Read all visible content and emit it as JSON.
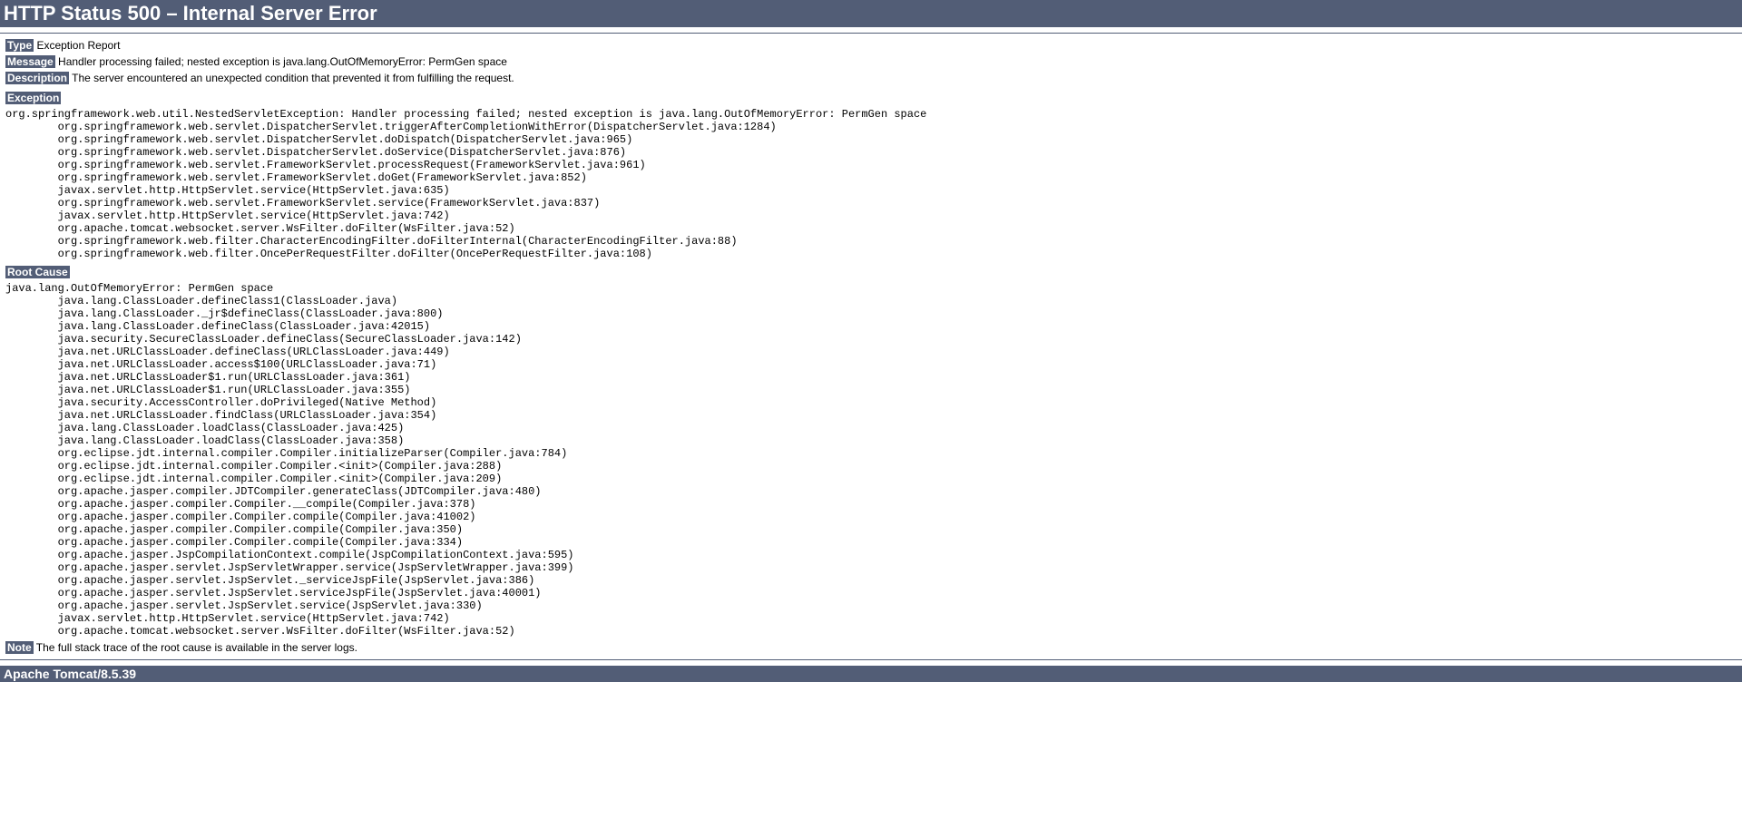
{
  "header": {
    "title": "HTTP Status 500 – Internal Server Error"
  },
  "labels": {
    "type": "Type",
    "message": "Message",
    "description": "Description",
    "exception": "Exception",
    "rootCause": "Root Cause",
    "note": "Note"
  },
  "values": {
    "type": " Exception Report",
    "message": " Handler processing failed; nested exception is java.lang.OutOfMemoryError: PermGen space",
    "description": " The server encountered an unexpected condition that prevented it from fulfilling the request.",
    "note": " The full stack trace of the root cause is available in the server logs."
  },
  "exceptionTrace": "org.springframework.web.util.NestedServletException: Handler processing failed; nested exception is java.lang.OutOfMemoryError: PermGen space\n\torg.springframework.web.servlet.DispatcherServlet.triggerAfterCompletionWithError(DispatcherServlet.java:1284)\n\torg.springframework.web.servlet.DispatcherServlet.doDispatch(DispatcherServlet.java:965)\n\torg.springframework.web.servlet.DispatcherServlet.doService(DispatcherServlet.java:876)\n\torg.springframework.web.servlet.FrameworkServlet.processRequest(FrameworkServlet.java:961)\n\torg.springframework.web.servlet.FrameworkServlet.doGet(FrameworkServlet.java:852)\n\tjavax.servlet.http.HttpServlet.service(HttpServlet.java:635)\n\torg.springframework.web.servlet.FrameworkServlet.service(FrameworkServlet.java:837)\n\tjavax.servlet.http.HttpServlet.service(HttpServlet.java:742)\n\torg.apache.tomcat.websocket.server.WsFilter.doFilter(WsFilter.java:52)\n\torg.springframework.web.filter.CharacterEncodingFilter.doFilterInternal(CharacterEncodingFilter.java:88)\n\torg.springframework.web.filter.OncePerRequestFilter.doFilter(OncePerRequestFilter.java:108)",
  "rootCauseTrace": "java.lang.OutOfMemoryError: PermGen space\n\tjava.lang.ClassLoader.defineClass1(ClassLoader.java)\n\tjava.lang.ClassLoader._jr$defineClass(ClassLoader.java:800)\n\tjava.lang.ClassLoader.defineClass(ClassLoader.java:42015)\n\tjava.security.SecureClassLoader.defineClass(SecureClassLoader.java:142)\n\tjava.net.URLClassLoader.defineClass(URLClassLoader.java:449)\n\tjava.net.URLClassLoader.access$100(URLClassLoader.java:71)\n\tjava.net.URLClassLoader$1.run(URLClassLoader.java:361)\n\tjava.net.URLClassLoader$1.run(URLClassLoader.java:355)\n\tjava.security.AccessController.doPrivileged(Native Method)\n\tjava.net.URLClassLoader.findClass(URLClassLoader.java:354)\n\tjava.lang.ClassLoader.loadClass(ClassLoader.java:425)\n\tjava.lang.ClassLoader.loadClass(ClassLoader.java:358)\n\torg.eclipse.jdt.internal.compiler.Compiler.initializeParser(Compiler.java:784)\n\torg.eclipse.jdt.internal.compiler.Compiler.<init>(Compiler.java:288)\n\torg.eclipse.jdt.internal.compiler.Compiler.<init>(Compiler.java:209)\n\torg.apache.jasper.compiler.JDTCompiler.generateClass(JDTCompiler.java:480)\n\torg.apache.jasper.compiler.Compiler.__compile(Compiler.java:378)\n\torg.apache.jasper.compiler.Compiler.compile(Compiler.java:41002)\n\torg.apache.jasper.compiler.Compiler.compile(Compiler.java:350)\n\torg.apache.jasper.compiler.Compiler.compile(Compiler.java:334)\n\torg.apache.jasper.JspCompilationContext.compile(JspCompilationContext.java:595)\n\torg.apache.jasper.servlet.JspServletWrapper.service(JspServletWrapper.java:399)\n\torg.apache.jasper.servlet.JspServlet._serviceJspFile(JspServlet.java:386)\n\torg.apache.jasper.servlet.JspServlet.serviceJspFile(JspServlet.java:40001)\n\torg.apache.jasper.servlet.JspServlet.service(JspServlet.java:330)\n\tjavax.servlet.http.HttpServlet.service(HttpServlet.java:742)\n\torg.apache.tomcat.websocket.server.WsFilter.doFilter(WsFilter.java:52)",
  "footer": {
    "server": "Apache Tomcat/8.5.39"
  }
}
